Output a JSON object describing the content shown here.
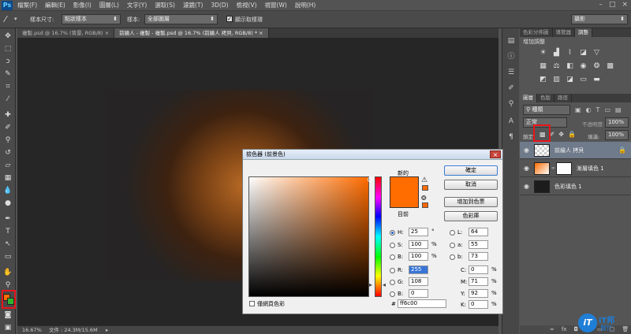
{
  "app": {
    "logo": "Ps"
  },
  "menubar": {
    "items": [
      "檔案(F)",
      "編輯(E)",
      "影像(I)",
      "圖層(L)",
      "文字(Y)",
      "選取(S)",
      "濾鏡(T)",
      "3D(D)",
      "檢視(V)",
      "視窗(W)",
      "說明(H)"
    ]
  },
  "window_controls": {
    "minimize": "–",
    "restore": "□",
    "close": "×"
  },
  "options": {
    "sample_size_label": "樣本尺寸:",
    "sample_size_value": "點狀樣本",
    "sample_label": "樣本:",
    "sample_value": "全部圖層",
    "show_ring_label": "顯示取樣環",
    "workspace_value": "攝影"
  },
  "tabs": [
    {
      "label": "複製.psd @ 16.7% (背景, RGB/8)"
    },
    {
      "label": "前繪人 - 複製 - 複製.psd @ 16.7% (前繪人 拷貝, RGB/8) *"
    }
  ],
  "status": {
    "zoom": "16.67%",
    "doc": "文件 : 24.3M/15.6M"
  },
  "panels": {
    "top_tabs": [
      "色彩分佈圖",
      "導覽器",
      "調整"
    ],
    "add_adjustment": "增加調整",
    "layer_tabs": [
      "圖層",
      "色版",
      "路徑"
    ],
    "kind_value": "種類",
    "blend_mode": "正常",
    "opacity_label": "不透明度:",
    "opacity_value": "100%",
    "lock_label": "鎖定:",
    "fill_label": "填滿:",
    "fill_value": "100%",
    "layers": [
      {
        "name": "前繪人 拷貝",
        "selected": true
      },
      {
        "name": "漸層填色 1",
        "selected": false
      },
      {
        "name": "色彩填色 1",
        "selected": false
      }
    ]
  },
  "dialog": {
    "title": "檢色器 (前景色)",
    "new_label": "新的",
    "current_label": "目前",
    "buttons": {
      "ok": "確定",
      "cancel": "取消",
      "add_swatch": "增加到色票",
      "libraries": "色彩庫"
    },
    "web_only_label": "僅網頁色彩",
    "hsb": {
      "H": "25",
      "S": "100",
      "B": "100",
      "H_unit": "°",
      "S_unit": "%",
      "B_unit": "%"
    },
    "rgb": {
      "R": "255",
      "G": "108",
      "B": "0"
    },
    "lab": {
      "L": "64",
      "a": "55",
      "b": "73"
    },
    "cmyk": {
      "C": "0",
      "M": "71",
      "Y": "92",
      "K": "0",
      "unit": "%"
    },
    "hex": "ff6c00",
    "labels": {
      "H": "H:",
      "S": "S:",
      "B": "B:",
      "R": "R:",
      "G": "G:",
      "Bb": "B:",
      "L": "L:",
      "a": "a:",
      "b": "b:",
      "C": "C:",
      "M": "M:",
      "Y": "Y:",
      "K": "K:",
      "hash": "#"
    }
  },
  "colors": {
    "current": "#ff6c00",
    "foreground": "#ff6c00",
    "background": "#2fb52f",
    "highlight": "#e8141a"
  },
  "watermark": {
    "brand": "iT邦",
    "sub": "幫忙"
  }
}
